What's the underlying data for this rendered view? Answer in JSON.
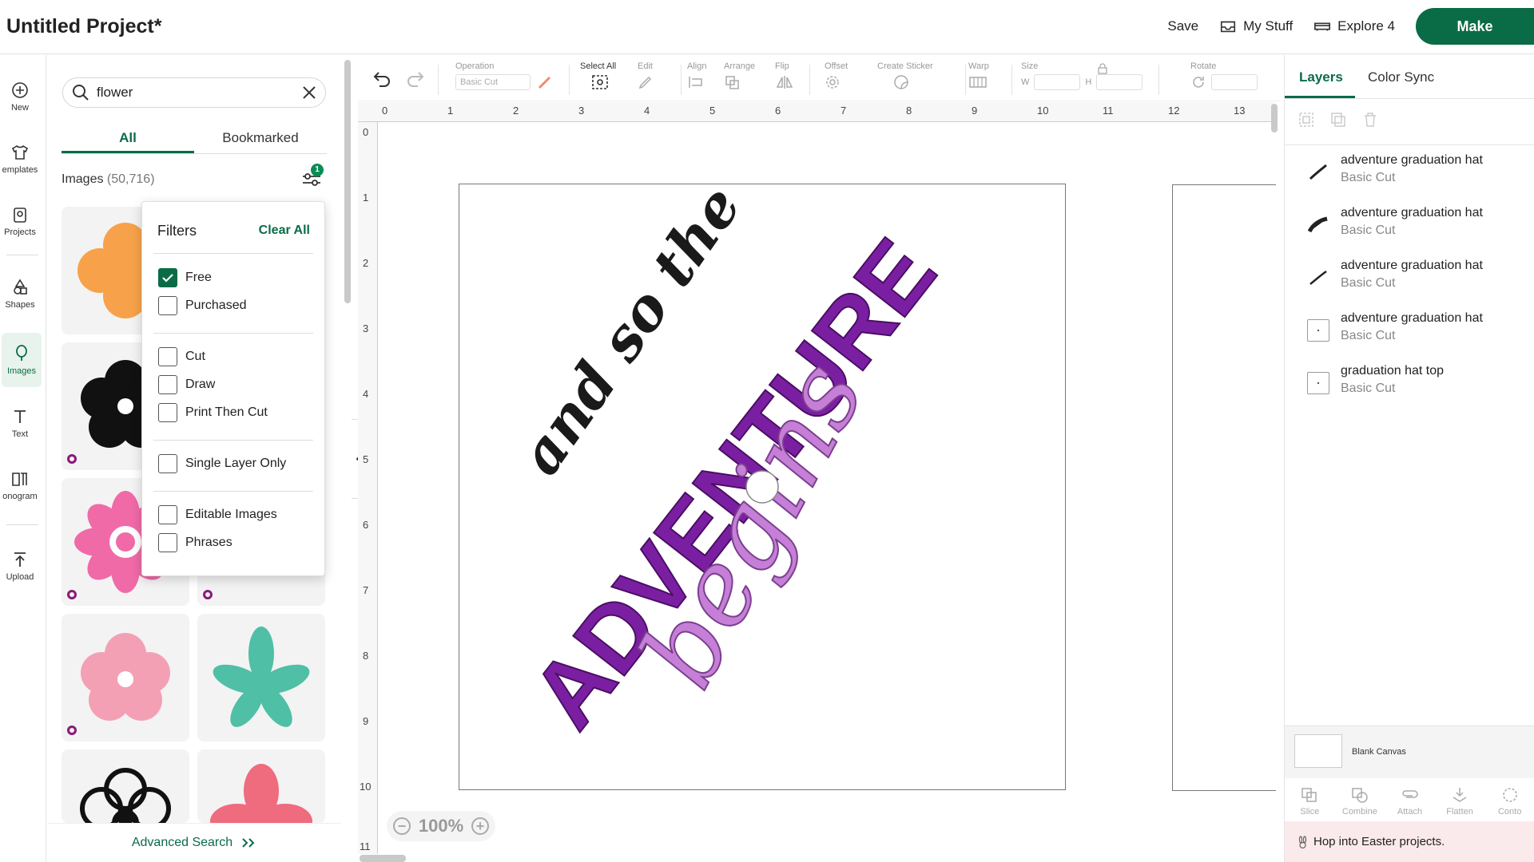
{
  "header": {
    "title": "Untitled Project*",
    "save_label": "Save",
    "mystuff_label": "My Stuff",
    "explore_label": "Explore 4",
    "make_label": "Make"
  },
  "rail": {
    "items": [
      {
        "label": "New"
      },
      {
        "label": "emplates"
      },
      {
        "label": "Projects"
      },
      {
        "label": "Shapes"
      },
      {
        "label": "Images"
      },
      {
        "label": "Text"
      },
      {
        "label": "onogram"
      },
      {
        "label": "Upload"
      }
    ]
  },
  "search": {
    "value": "flower"
  },
  "tabs": {
    "all": "All",
    "bookmarked": "Bookmarked"
  },
  "images": {
    "label": "Images",
    "count": "(50,716)",
    "filter_badge": "1"
  },
  "filters": {
    "title": "Filters",
    "clear_all": "Clear All",
    "options": [
      {
        "label": "Free",
        "checked": true
      },
      {
        "label": "Purchased",
        "checked": false
      },
      {
        "label": "Cut",
        "checked": false
      },
      {
        "label": "Draw",
        "checked": false
      },
      {
        "label": "Print Then Cut",
        "checked": false
      },
      {
        "label": "Single Layer Only",
        "checked": false
      },
      {
        "label": "Editable Images",
        "checked": false
      },
      {
        "label": "Phrases",
        "checked": false
      }
    ]
  },
  "advanced_search": "Advanced Search",
  "toolbar": {
    "operation": "Operation",
    "operation_value": "Basic Cut",
    "select_all": "Select All",
    "edit": "Edit",
    "align": "Align",
    "arrange": "Arrange",
    "flip": "Flip",
    "offset": "Offset",
    "create_sticker": "Create Sticker",
    "warp": "Warp",
    "size": "Size",
    "size_w": "W",
    "size_h": "H",
    "rotate": "Rotate"
  },
  "ruler": {
    "top": [
      "0",
      "1",
      "2",
      "3",
      "4",
      "5",
      "6",
      "7",
      "8",
      "9",
      "10",
      "11",
      "12",
      "13"
    ],
    "left": [
      "0",
      "1",
      "2",
      "3",
      "4",
      "5",
      "6",
      "7",
      "8",
      "9",
      "10",
      "11"
    ]
  },
  "design": {
    "line1": "and so the",
    "line2": "ADVENTURE",
    "line3": "begins",
    "colors": {
      "black": "#1a1a1a",
      "purple": "#7b1fa2",
      "lilac": "#c57fd6"
    }
  },
  "zoom": {
    "value": "100%",
    "minus": "−",
    "plus": "+"
  },
  "right": {
    "tab_layers": "Layers",
    "tab_colorsync": "Color Sync",
    "layers": [
      {
        "name": "adventure graduation hat",
        "op": "Basic Cut"
      },
      {
        "name": "adventure graduation hat",
        "op": "Basic Cut"
      },
      {
        "name": "adventure graduation hat",
        "op": "Basic Cut"
      },
      {
        "name": "adventure graduation hat",
        "op": "Basic Cut"
      },
      {
        "name": "graduation hat top",
        "op": "Basic Cut"
      }
    ],
    "blank_canvas": "Blank Canvas",
    "tools": [
      "Slice",
      "Combine",
      "Attach",
      "Flatten",
      "Conto"
    ],
    "promo": "Hop into Easter projects."
  }
}
